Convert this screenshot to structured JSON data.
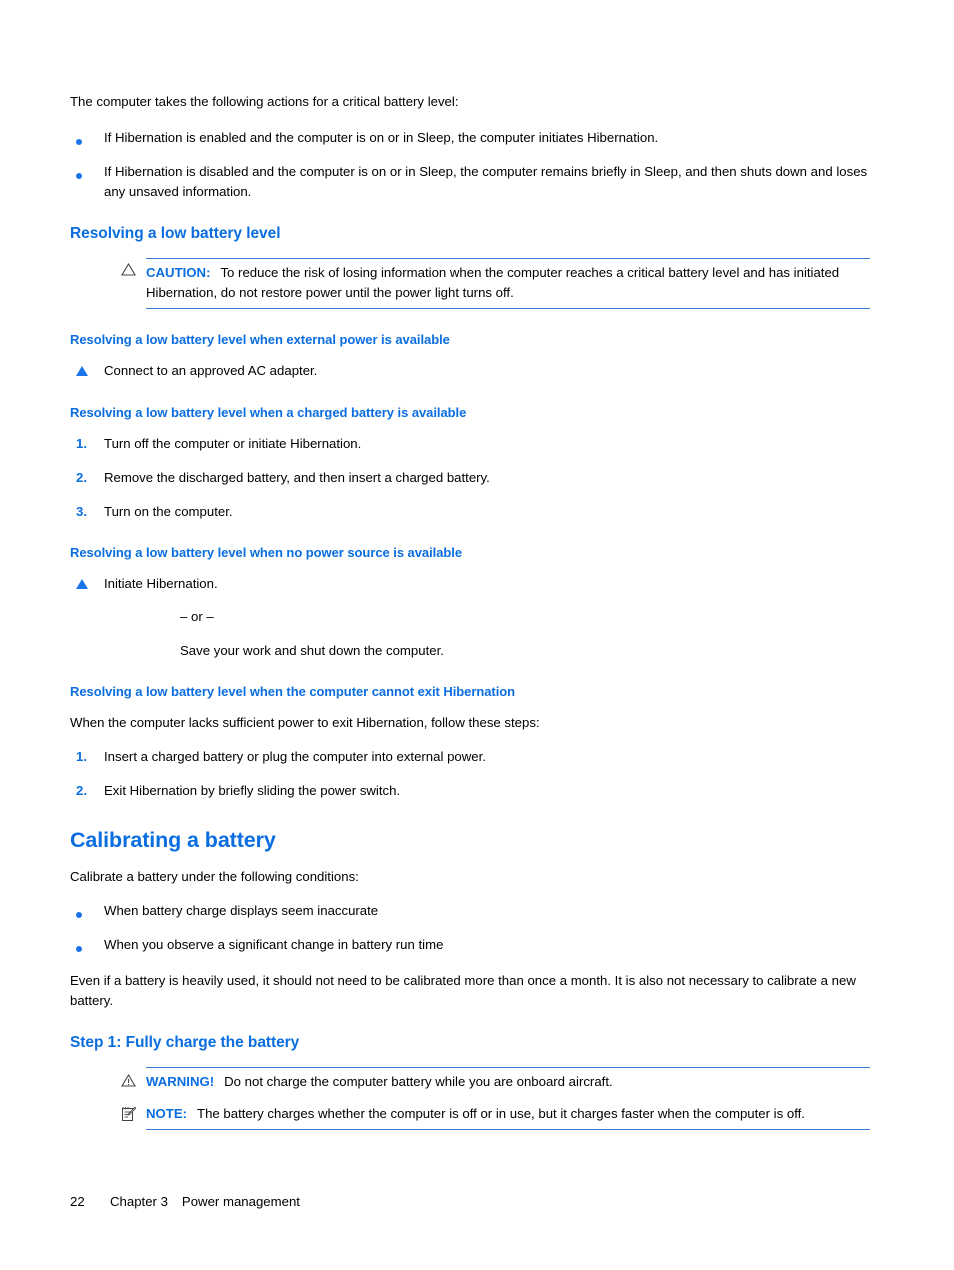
{
  "document": {
    "intro_paragraph": "The computer takes the following actions for a critical battery level:",
    "intro_bullets": [
      "If Hibernation is enabled and the computer is on or in Sleep, the computer initiates Hibernation.",
      "If Hibernation is disabled and the computer is on or in Sleep, the computer remains briefly in Sleep, and then shuts down and loses any unsaved information."
    ],
    "heading_resolving": "Resolving a low battery level",
    "caution": {
      "icon": "caution-triangle-icon",
      "label": "CAUTION:",
      "text": "To reduce the risk of losing information when the computer reaches a critical battery level and has initiated Hibernation, do not restore power until the power light turns off."
    },
    "section_external_power": {
      "heading": "Resolving a low battery level when external power is available",
      "marker": "triangle-bullet",
      "step": "Connect to an approved AC adapter."
    },
    "section_charged_battery": {
      "heading": "Resolving a low battery level when a charged battery is available",
      "steps": [
        {
          "num": "1.",
          "text": "Turn off the computer or initiate Hibernation."
        },
        {
          "num": "2.",
          "text": "Remove the discharged battery, and then insert a charged battery."
        },
        {
          "num": "3.",
          "text": "Turn on the computer."
        }
      ]
    },
    "section_no_power": {
      "heading": "Resolving a low battery level when no power source is available",
      "marker": "triangle-bullet",
      "step": "Initiate Hibernation.",
      "or_separator": "– or –",
      "alternate": "Save your work and shut down the computer."
    },
    "section_cannot_exit": {
      "heading": "Resolving a low battery level when the computer cannot exit Hibernation",
      "intro": "When the computer lacks sufficient power to exit Hibernation, follow these steps:",
      "steps": [
        {
          "num": "1.",
          "text": "Insert a charged battery or plug the computer into external power."
        },
        {
          "num": "2.",
          "text": "Exit Hibernation by briefly sliding the power switch."
        }
      ]
    },
    "heading_calibrating": "Calibrating a battery",
    "calibrating": {
      "intro": "Calibrate a battery under the following conditions:",
      "bullets": [
        "When battery charge displays seem inaccurate",
        "When you observe a significant change in battery run time"
      ],
      "note_paragraph": "Even if a battery is heavily used, it should not need to be calibrated more than once a month. It is also not necessary to calibrate a new battery."
    },
    "heading_step1": "Step 1: Fully charge the battery",
    "warning": {
      "icon": "warning-triangle-icon",
      "label": "WARNING!",
      "text": "Do not charge the computer battery while you are onboard aircraft."
    },
    "note": {
      "icon": "note-pad-icon",
      "label": "NOTE:",
      "text": "The battery charges whether the computer is off or in use, but it charges faster when the computer is off."
    },
    "footer": {
      "page_number": "22",
      "chapter": "Chapter 3",
      "chapter_title": "Power management"
    },
    "colors": {
      "accent_blue": "#0a6ee0",
      "marker_blue": "#1a73e8",
      "rule_blue": "#3b7fd4",
      "body_black": "#000000"
    }
  }
}
